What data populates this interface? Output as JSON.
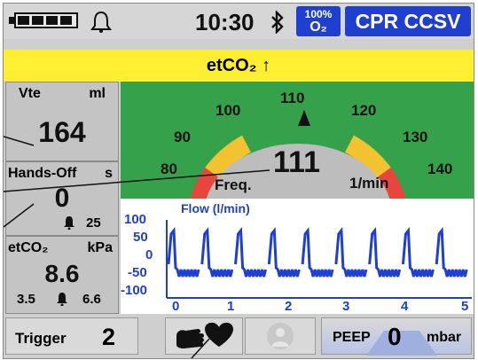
{
  "status": {
    "battery_level": 1.0,
    "icons": [
      "battery-icon",
      "bell-icon",
      "bluetooth-icon"
    ],
    "time": "10:30",
    "o2": {
      "percent": "100%",
      "label": "O₂"
    },
    "mode": "CPR CCSV"
  },
  "alarm": {
    "text": "etCO₂ ↑",
    "color": "#ffef33"
  },
  "vte": {
    "label": "Vte",
    "unit": "ml",
    "value": "164"
  },
  "hands_off": {
    "label": "Hands-Off",
    "unit": "s",
    "value": "0",
    "alarm_limit": "25"
  },
  "etco2": {
    "label": "etCO₂",
    "unit": "kPa",
    "value": "8.6",
    "low_limit": "3.5",
    "high_limit": "6.6"
  },
  "freq": {
    "label": "Freq.",
    "value": "111",
    "unit": "1/min",
    "target": 110,
    "ticks": [
      "80",
      "90",
      "100",
      "110",
      "120",
      "130",
      "140"
    ]
  },
  "flow": {
    "title": "Flow (l/min)",
    "y_ticks": [
      "100",
      "50",
      "0",
      "-50",
      "-100"
    ],
    "x_ticks": [
      "0",
      "1",
      "2",
      "3",
      "4",
      "5"
    ]
  },
  "controls": {
    "trigger_label": "Trigger",
    "trigger_value": "2",
    "peep_label": "PEEP",
    "peep_value": "0",
    "peep_unit": "mbar"
  },
  "colors": {
    "accent_blue": "#1f3fd0",
    "gauge_green": "#35a24b",
    "zone_red": "#e8453c",
    "zone_yellow": "#f2c230",
    "zone_grey": "#bdbdbd"
  }
}
